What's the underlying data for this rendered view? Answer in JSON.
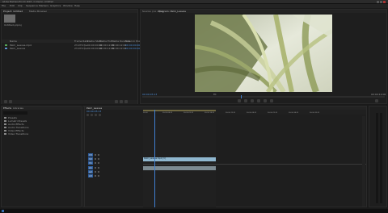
{
  "window": {
    "title": "Adobe Premiere Pro CC 2018 - C:\\Users\\...\\Untitled"
  },
  "menu": [
    "File",
    "Edit",
    "Clip",
    "Sequence",
    "Markers",
    "Graphics",
    "Window",
    "Help"
  ],
  "project_panel": {
    "tabs": [
      "Project: Untitled",
      "Media Browser"
    ],
    "project_name": "Untitled.prproj",
    "columns": [
      "Name",
      "Frame Rate",
      "Media Start",
      "Media End",
      "Media Duration",
      "Video In Point"
    ],
    "items": [
      {
        "name": "Palm_Leaves.mp4",
        "values": [
          "23.976 fps",
          "00:00:00:00",
          "00:00:12:05",
          "00:00:12:06",
          "00:00:00:00"
        ]
      },
      {
        "name": "Palm_Leaves",
        "values": [
          "23.976 fps",
          "00:00:00:00",
          "00:00:12:05",
          "00:00:12:06",
          "00:00:00:00"
        ]
      }
    ]
  },
  "program_monitor": {
    "tabs": [
      "Source: (no clips)",
      "Program: Palm_Leaves"
    ],
    "timecode_left": "00:00:05:13",
    "timecode_right": "00:00:12:06",
    "fit": "Fit",
    "image": "palm-leaves"
  },
  "left_panel": {
    "tabs": [
      "Effects",
      "Libraries"
    ],
    "items": [
      "Presets",
      "Lumetri Presets",
      "Audio Effects",
      "Audio Transitions",
      "Video Effects",
      "Video Transitions"
    ]
  },
  "timeline": {
    "tab": "Palm_Leaves",
    "timecode": "00:00:05:13",
    "tracks": [
      "V3",
      "V2",
      "V1",
      "A1",
      "A2",
      "A3"
    ],
    "clip_label": "Palm_Leaves.mp4 [V]",
    "ruler_marks": [
      "00:00",
      "00:00:04:23",
      "00:00:09:23",
      "00:00:14:23",
      "00:00:19:23",
      "00:00:24:23",
      "00:00:29:23",
      "00:00:34:23",
      "00:00:39:23"
    ]
  },
  "colors": {
    "accent": "#3f7fd0",
    "clip": "#8fb7cf",
    "bg": "#1a1a1a"
  }
}
